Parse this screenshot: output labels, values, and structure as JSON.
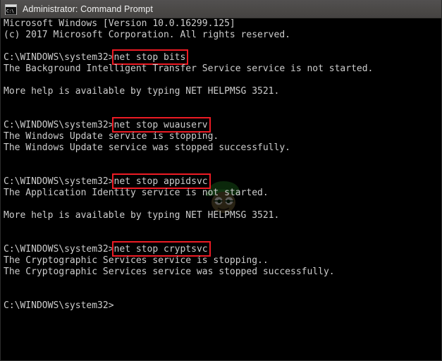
{
  "window": {
    "title": "Administrator: Command Prompt",
    "icon": "console-window-icon",
    "icon_label": "C:\\",
    "titlebar_color": "#4c4a48",
    "background_color": "#000000",
    "text_color": "#cdcdcd",
    "highlight_color": "#ed1b24"
  },
  "console": {
    "prompt": "C:\\WINDOWS\\system32>",
    "lines": [
      {
        "text": "Microsoft Windows [Version 10.0.16299.125]"
      },
      {
        "text": "(c) 2017 Microsoft Corporation. All rights reserved."
      },
      {
        "text": ""
      },
      {
        "prompt": "C:\\WINDOWS\\system32>",
        "command": "net stop bits",
        "highlighted": true
      },
      {
        "text": "The Background Intelligent Transfer Service service is not started."
      },
      {
        "text": ""
      },
      {
        "text": "More help is available by typing NET HELPMSG 3521."
      },
      {
        "text": ""
      },
      {
        "text": ""
      },
      {
        "prompt": "C:\\WINDOWS\\system32>",
        "command": "net stop wuauserv",
        "highlighted": true
      },
      {
        "text": "The Windows Update service is stopping."
      },
      {
        "text": "The Windows Update service was stopped successfully."
      },
      {
        "text": ""
      },
      {
        "text": ""
      },
      {
        "prompt": "C:\\WINDOWS\\system32>",
        "command": "net stop appidsvc",
        "highlighted": true
      },
      {
        "text": "The Application Identity service is not started."
      },
      {
        "text": ""
      },
      {
        "text": "More help is available by typing NET HELPMSG 3521."
      },
      {
        "text": ""
      },
      {
        "text": ""
      },
      {
        "prompt": "C:\\WINDOWS\\system32>",
        "command": "net stop cryptsvc",
        "highlighted": true
      },
      {
        "text": "The Cryptographic Services service is stopping.."
      },
      {
        "text": "The Cryptographic Services service was stopped successfully."
      },
      {
        "text": ""
      },
      {
        "text": ""
      },
      {
        "prompt": "C:\\WINDOWS\\system32>",
        "command": "",
        "highlighted": false
      }
    ]
  }
}
